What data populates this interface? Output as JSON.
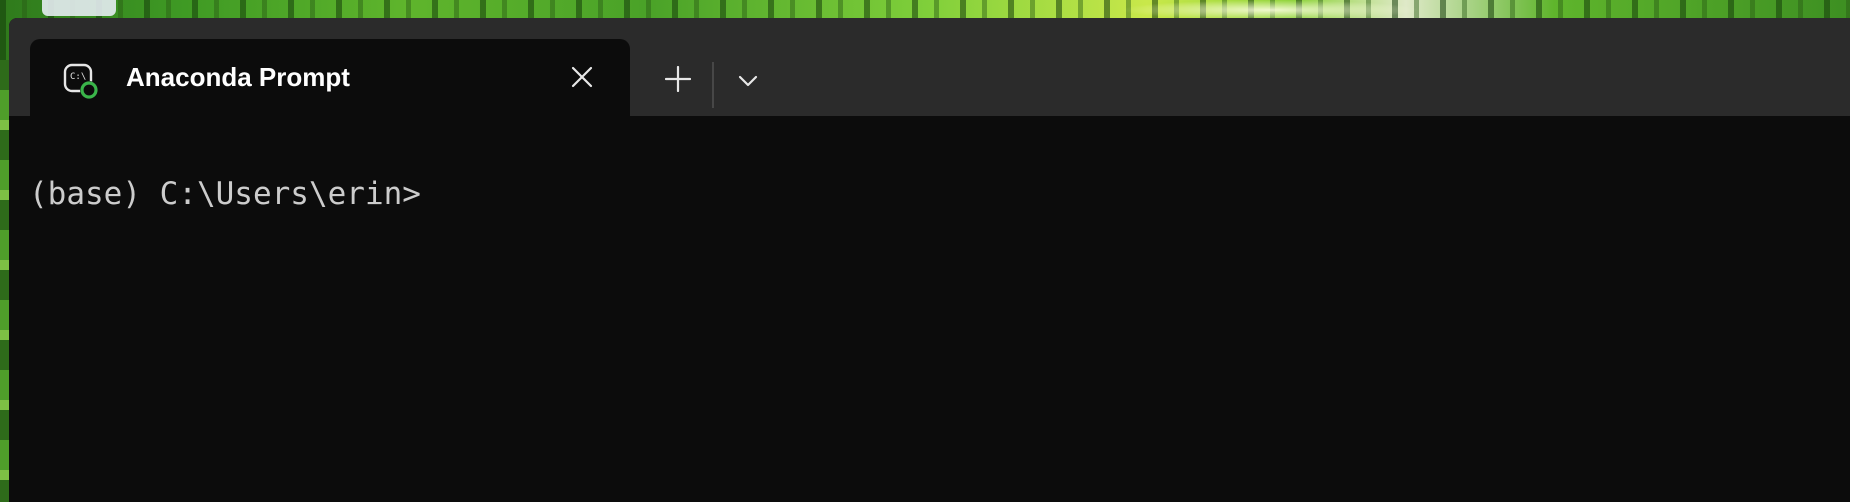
{
  "window": {
    "active_tab": {
      "title": "Anaconda Prompt",
      "icon": "anaconda-terminal-icon",
      "close_icon": "close-icon"
    },
    "new_tab_icon": "plus-icon",
    "dropdown_icon": "chevron-down-icon"
  },
  "terminal": {
    "lines": [
      "(base) C:\\Users\\erin>"
    ]
  },
  "colors": {
    "titlebar": "#2b2b2b",
    "tab_background": "#0c0c0c",
    "terminal_background": "#0c0c0c",
    "terminal_text": "#cccccc",
    "icon_accent_green": "#3ab54a"
  }
}
